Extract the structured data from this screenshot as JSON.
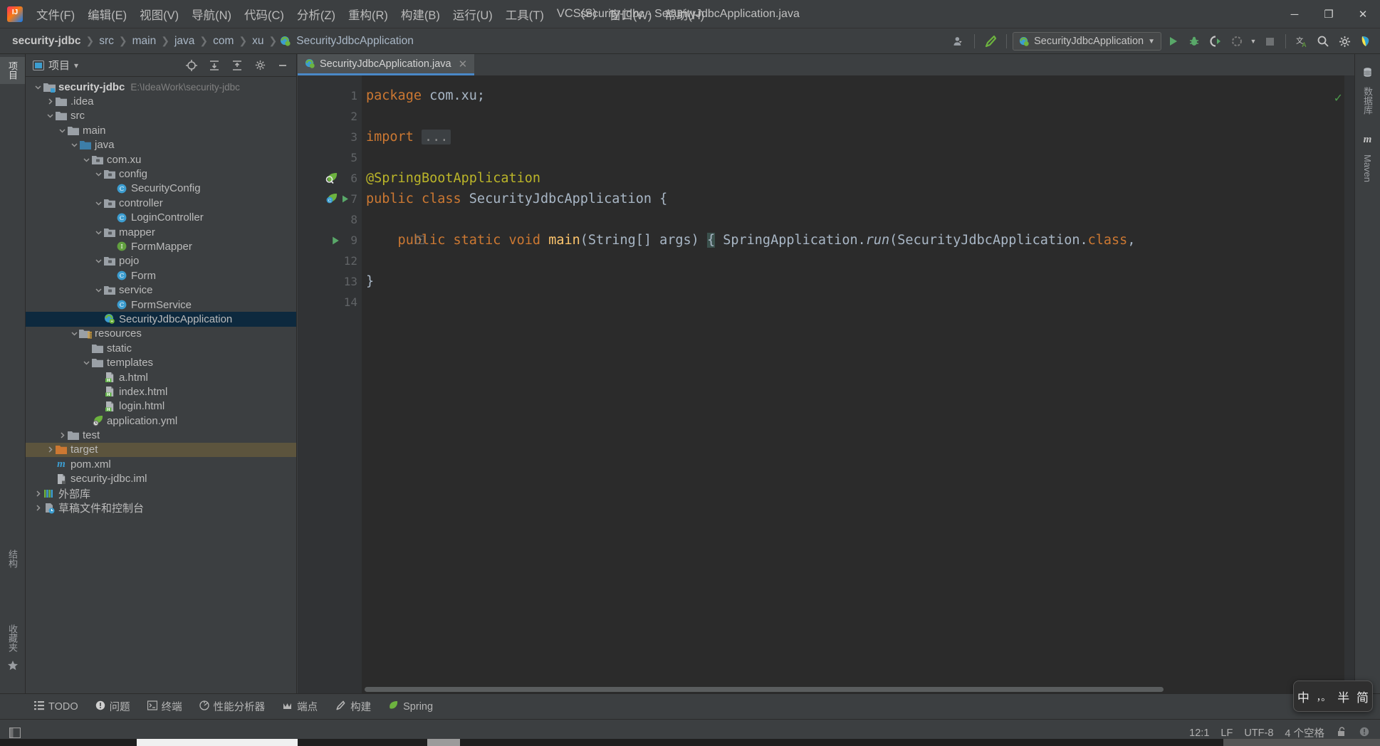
{
  "window": {
    "title": "security-jdbc - SecurityJdbcApplication.java",
    "minimize": "─",
    "maximize": "❐",
    "close": "✕",
    "logo": "intellij-idea-logo"
  },
  "menubar": [
    {
      "label": "文件(F)",
      "name": "menu-file"
    },
    {
      "label": "编辑(E)",
      "name": "menu-edit"
    },
    {
      "label": "视图(V)",
      "name": "menu-view"
    },
    {
      "label": "导航(N)",
      "name": "menu-navigate"
    },
    {
      "label": "代码(C)",
      "name": "menu-code"
    },
    {
      "label": "分析(Z)",
      "name": "menu-analyze"
    },
    {
      "label": "重构(R)",
      "name": "menu-refactor"
    },
    {
      "label": "构建(B)",
      "name": "menu-build"
    },
    {
      "label": "运行(U)",
      "name": "menu-run"
    },
    {
      "label": "工具(T)",
      "name": "menu-tools"
    },
    {
      "label": "VCS(S)",
      "name": "menu-vcs"
    },
    {
      "label": "窗口(W)",
      "name": "menu-window"
    },
    {
      "label": "帮助(H)",
      "name": "menu-help"
    }
  ],
  "breadcrumbs": [
    {
      "label": "security-jdbc",
      "bold": true
    },
    {
      "label": "src",
      "bold": false
    },
    {
      "label": "main",
      "bold": false
    },
    {
      "label": "java",
      "bold": false
    },
    {
      "label": "com",
      "bold": false
    },
    {
      "label": "xu",
      "bold": false
    },
    {
      "label": "SecurityJdbcApplication",
      "bold": false,
      "icon": "spring-class-icon"
    }
  ],
  "toolbar": {
    "run_config_label": "SecurityJdbcApplication",
    "run_config_dropdown": "▼",
    "buttons": [
      {
        "name": "user-settings-icon",
        "glyph": "♟"
      },
      {
        "name": "build-hammer-icon",
        "glyph": "⚒"
      },
      {
        "name": "run-button",
        "glyph": "▶"
      },
      {
        "name": "debug-button",
        "glyph": "🐞"
      },
      {
        "name": "run-with-coverage-button",
        "glyph": "◑"
      },
      {
        "name": "profile-button",
        "glyph": "◌"
      },
      {
        "name": "stop-button",
        "glyph": "■"
      },
      {
        "name": "translate-icon",
        "glyph": "文"
      },
      {
        "name": "search-everywhere-icon",
        "glyph": "🔍"
      },
      {
        "name": "settings-gear-icon",
        "glyph": "⚙"
      },
      {
        "name": "ide-assistant-icon",
        "glyph": "◗"
      }
    ]
  },
  "left_strip": [
    {
      "label": "项目",
      "name": "tool-window-project",
      "active": true
    },
    {
      "label": "结构",
      "name": "tool-window-structure",
      "active": false
    },
    {
      "label": "收藏夹",
      "name": "tool-window-favorites",
      "active": false
    }
  ],
  "right_strip": [
    {
      "label": "数据库",
      "name": "tool-window-database"
    },
    {
      "label": "Maven",
      "name": "tool-window-maven"
    }
  ],
  "project_panel": {
    "title": "项目",
    "dropdown": "▾",
    "actions": [
      {
        "name": "select-opened-file-icon",
        "glyph": "⊕"
      },
      {
        "name": "expand-all-icon",
        "glyph": "≡"
      },
      {
        "name": "collapse-all-icon",
        "glyph": "≣"
      },
      {
        "name": "panel-settings-icon",
        "glyph": "⚙"
      },
      {
        "name": "hide-panel-icon",
        "glyph": "─"
      }
    ],
    "tree": [
      {
        "label": "security-jdbc",
        "path": "E:\\IdeaWork\\security-jdbc",
        "depth": 0,
        "arrow": "down",
        "icon": "project-folder",
        "bold": true,
        "state": "normal"
      },
      {
        "label": ".idea",
        "path": "",
        "depth": 1,
        "arrow": "right",
        "icon": "folder",
        "bold": false,
        "state": "normal"
      },
      {
        "label": "src",
        "path": "",
        "depth": 1,
        "arrow": "down",
        "icon": "folder",
        "bold": false,
        "state": "normal"
      },
      {
        "label": "main",
        "path": "",
        "depth": 2,
        "arrow": "down",
        "icon": "folder",
        "bold": false,
        "state": "normal"
      },
      {
        "label": "java",
        "path": "",
        "depth": 3,
        "arrow": "down",
        "icon": "source-folder",
        "bold": false,
        "state": "normal"
      },
      {
        "label": "com.xu",
        "path": "",
        "depth": 4,
        "arrow": "down",
        "icon": "package",
        "bold": false,
        "state": "normal"
      },
      {
        "label": "config",
        "path": "",
        "depth": 5,
        "arrow": "down",
        "icon": "package",
        "bold": false,
        "state": "normal"
      },
      {
        "label": "SecurityConfig",
        "path": "",
        "depth": 6,
        "arrow": "none",
        "icon": "java-class",
        "bold": false,
        "state": "normal"
      },
      {
        "label": "controller",
        "path": "",
        "depth": 5,
        "arrow": "down",
        "icon": "package",
        "bold": false,
        "state": "normal"
      },
      {
        "label": "LoginController",
        "path": "",
        "depth": 6,
        "arrow": "none",
        "icon": "java-class",
        "bold": false,
        "state": "normal"
      },
      {
        "label": "mapper",
        "path": "",
        "depth": 5,
        "arrow": "down",
        "icon": "package",
        "bold": false,
        "state": "normal"
      },
      {
        "label": "FormMapper",
        "path": "",
        "depth": 6,
        "arrow": "none",
        "icon": "java-interface",
        "bold": false,
        "state": "normal"
      },
      {
        "label": "pojo",
        "path": "",
        "depth": 5,
        "arrow": "down",
        "icon": "package",
        "bold": false,
        "state": "normal"
      },
      {
        "label": "Form",
        "path": "",
        "depth": 6,
        "arrow": "none",
        "icon": "java-class",
        "bold": false,
        "state": "normal"
      },
      {
        "label": "service",
        "path": "",
        "depth": 5,
        "arrow": "down",
        "icon": "package",
        "bold": false,
        "state": "normal"
      },
      {
        "label": "FormService",
        "path": "",
        "depth": 6,
        "arrow": "none",
        "icon": "java-class",
        "bold": false,
        "state": "normal"
      },
      {
        "label": "SecurityJdbcApplication",
        "path": "",
        "depth": 5,
        "arrow": "none",
        "icon": "spring-class",
        "bold": false,
        "state": "selected"
      },
      {
        "label": "resources",
        "path": "",
        "depth": 3,
        "arrow": "down",
        "icon": "resource-folder",
        "bold": false,
        "state": "normal"
      },
      {
        "label": "static",
        "path": "",
        "depth": 4,
        "arrow": "none",
        "icon": "folder",
        "bold": false,
        "state": "normal"
      },
      {
        "label": "templates",
        "path": "",
        "depth": 4,
        "arrow": "down",
        "icon": "folder",
        "bold": false,
        "state": "normal"
      },
      {
        "label": "a.html",
        "path": "",
        "depth": 5,
        "arrow": "none",
        "icon": "html-file",
        "bold": false,
        "state": "normal"
      },
      {
        "label": "index.html",
        "path": "",
        "depth": 5,
        "arrow": "none",
        "icon": "html-file",
        "bold": false,
        "state": "normal"
      },
      {
        "label": "login.html",
        "path": "",
        "depth": 5,
        "arrow": "none",
        "icon": "html-file",
        "bold": false,
        "state": "normal"
      },
      {
        "label": "application.yml",
        "path": "",
        "depth": 4,
        "arrow": "none",
        "icon": "spring-yml",
        "bold": false,
        "state": "normal"
      },
      {
        "label": "test",
        "path": "",
        "depth": 2,
        "arrow": "right",
        "icon": "folder",
        "bold": false,
        "state": "normal"
      },
      {
        "label": "target",
        "path": "",
        "depth": 1,
        "arrow": "right",
        "icon": "folder-orange",
        "bold": false,
        "state": "highlight"
      },
      {
        "label": "pom.xml",
        "path": "",
        "depth": 1,
        "arrow": "none",
        "icon": "maven-file",
        "bold": false,
        "state": "normal"
      },
      {
        "label": "security-jdbc.iml",
        "path": "",
        "depth": 1,
        "arrow": "none",
        "icon": "iml-file",
        "bold": false,
        "state": "normal"
      },
      {
        "label": "外部库",
        "path": "",
        "depth": 0,
        "arrow": "right",
        "icon": "library",
        "bold": false,
        "state": "normal"
      },
      {
        "label": "草稿文件和控制台",
        "path": "",
        "depth": 0,
        "arrow": "right",
        "icon": "scratches",
        "bold": false,
        "state": "normal"
      }
    ]
  },
  "editor": {
    "tab": {
      "label": "SecurityJdbcApplication.java",
      "close": "✕",
      "icon": "spring-class-icon"
    },
    "inspection_status": "✓",
    "lines": [
      {
        "number": "1",
        "gutter": "",
        "segments": [
          {
            "t": "package ",
            "c": "kw"
          },
          {
            "t": "com.xu;",
            "c": "plain"
          }
        ],
        "indent": 0
      },
      {
        "number": "2",
        "gutter": "",
        "segments": [],
        "indent": 0
      },
      {
        "number": "3",
        "gutter": "",
        "fold": "+",
        "segments": [
          {
            "t": "import ",
            "c": "kw"
          },
          {
            "t": "...",
            "c": "dots"
          }
        ],
        "indent": 0
      },
      {
        "number": "5",
        "gutter": "",
        "segments": [],
        "indent": 0
      },
      {
        "number": "6",
        "gutter": "spring-search",
        "segments": [
          {
            "t": "@SpringBootApplication",
            "c": "ann"
          }
        ],
        "indent": 0
      },
      {
        "number": "7",
        "gutter": "spring-class-run",
        "segments": [
          {
            "t": "public class ",
            "c": "kw"
          },
          {
            "t": "SecurityJdbcApplication ",
            "c": "cls"
          },
          {
            "t": "{",
            "c": "plain"
          }
        ],
        "indent": 0
      },
      {
        "number": "8",
        "gutter": "",
        "segments": [],
        "indent": 0
      },
      {
        "number": "9",
        "gutter": "run",
        "fold": "+",
        "segments": [
          {
            "t": "    public static void ",
            "c": "kw"
          },
          {
            "t": "main",
            "c": "fn"
          },
          {
            "t": "(String[] args) ",
            "c": "plain"
          },
          {
            "t": "{",
            "c": "brace"
          },
          {
            "t": " SpringApplication.",
            "c": "plain"
          },
          {
            "t": "run",
            "c": "italic-plain"
          },
          {
            "t": "(SecurityJdbcApplication.",
            "c": "plain"
          },
          {
            "t": "class",
            "c": "kw"
          },
          {
            "t": ",",
            "c": "plain"
          }
        ],
        "indent": 0
      },
      {
        "number": "12",
        "gutter": "",
        "segments": [],
        "indent": 0
      },
      {
        "number": "13",
        "gutter": "",
        "segments": [
          {
            "t": "}",
            "c": "plain"
          }
        ],
        "indent": 0
      },
      {
        "number": "14",
        "gutter": "",
        "segments": [],
        "indent": 0
      }
    ]
  },
  "bottom_strip": [
    {
      "label": "TODO",
      "name": "tool-window-todo",
      "glyph": "≡"
    },
    {
      "label": "问题",
      "name": "tool-window-problems",
      "glyph": "❗"
    },
    {
      "label": "终端",
      "name": "tool-window-terminal",
      "glyph": "▣"
    },
    {
      "label": "性能分析器",
      "name": "tool-window-profiler",
      "glyph": "◔"
    },
    {
      "label": "端点",
      "name": "tool-window-endpoints",
      "glyph": "⑂"
    },
    {
      "label": "构建",
      "name": "tool-window-build",
      "glyph": "⬈"
    },
    {
      "label": "Spring",
      "name": "tool-window-spring",
      "glyph": "◖"
    }
  ],
  "statusbar": {
    "caret_position": "12:1",
    "line_separator": "LF",
    "encoding": "UTF-8",
    "indent": "4 个空格",
    "lock_icon": "🔓",
    "notification_icon": "❗",
    "show_hide_icon": "▧"
  },
  "ime_popup": {
    "mode": "中",
    "punct": "，。",
    "width": "半",
    "script": "简"
  }
}
